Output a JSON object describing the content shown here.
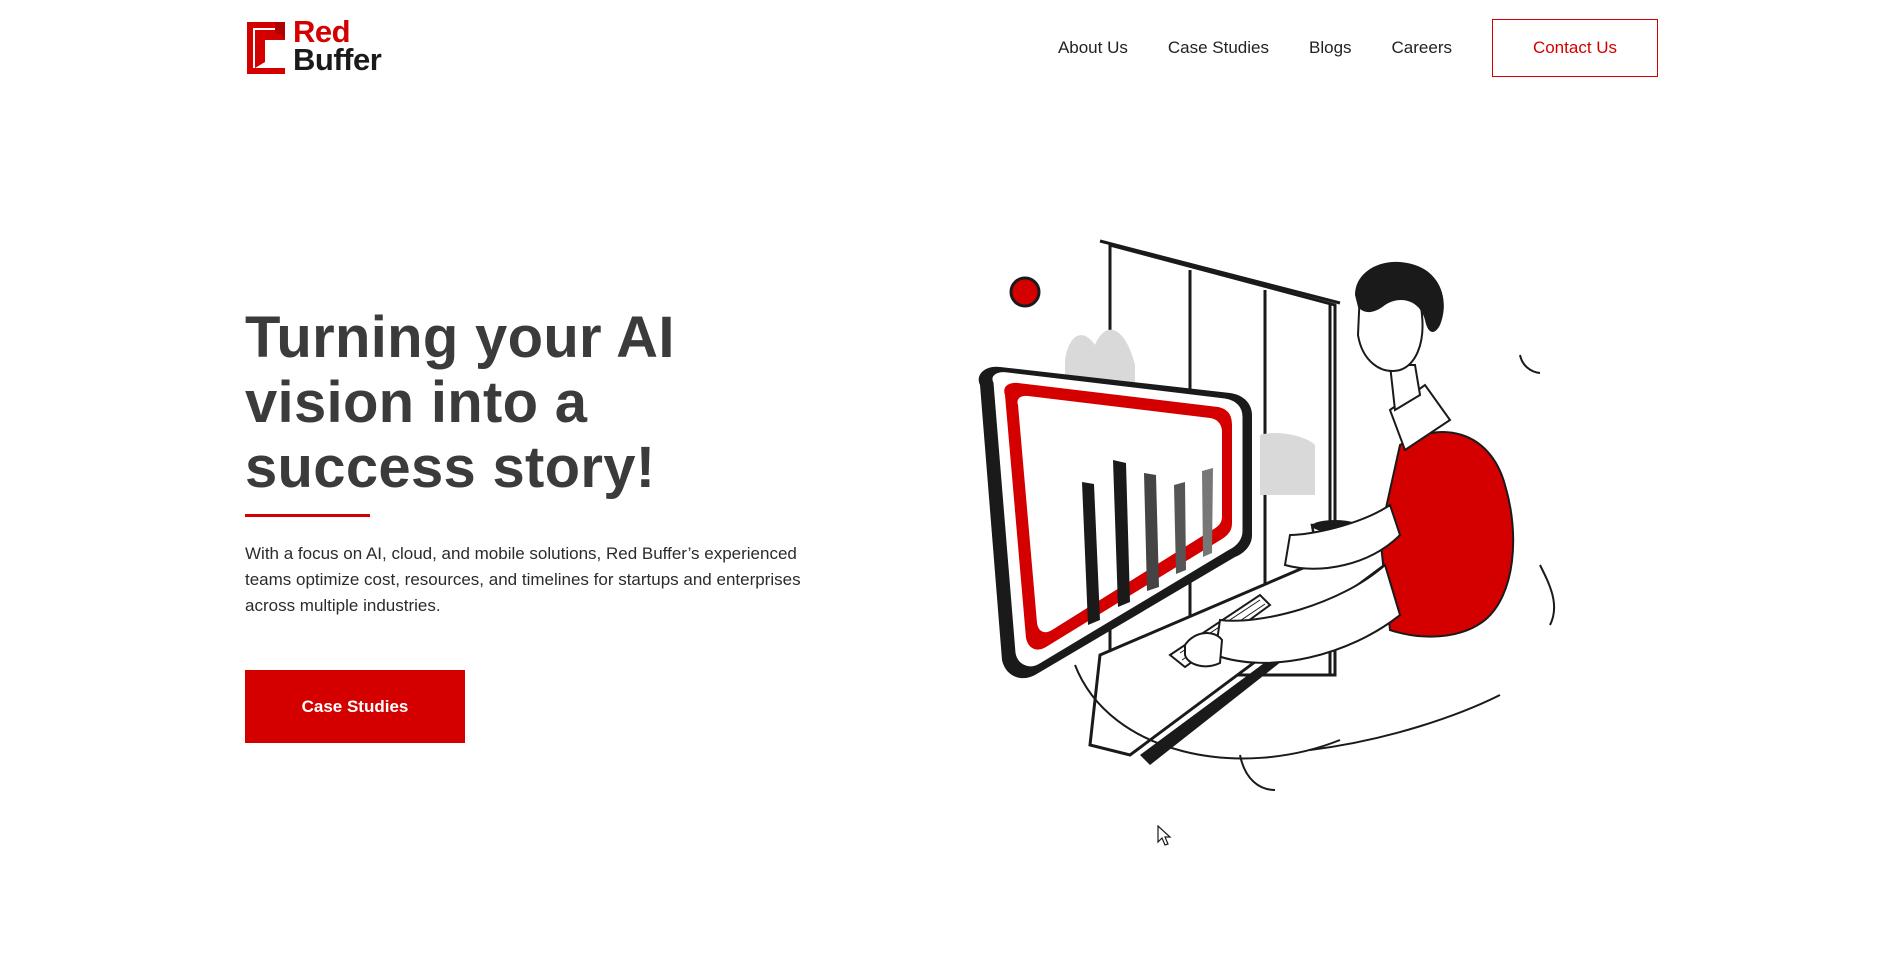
{
  "header": {
    "logo": {
      "line1": "Red",
      "line2": "Buffer"
    },
    "nav": [
      {
        "label": "About Us"
      },
      {
        "label": "Case Studies"
      },
      {
        "label": "Blogs"
      },
      {
        "label": "Careers"
      }
    ],
    "contact_label": "Contact Us"
  },
  "hero": {
    "title": "Turning your AI vision into a success story!",
    "description": "With a focus on AI, cloud, and mobile solutions, Red Buffer’s experienced teams optimize cost, resources, and timelines for startups and enterprises across multiple industries.",
    "cta_label": "Case Studies"
  },
  "colors": {
    "brand_red": "#d40000",
    "heading": "#3b3b3b",
    "text": "#2b2b2b"
  },
  "icons": {
    "logo_mark": "red-square-bracket-logo",
    "pointer": "mouse-pointer-icon"
  }
}
